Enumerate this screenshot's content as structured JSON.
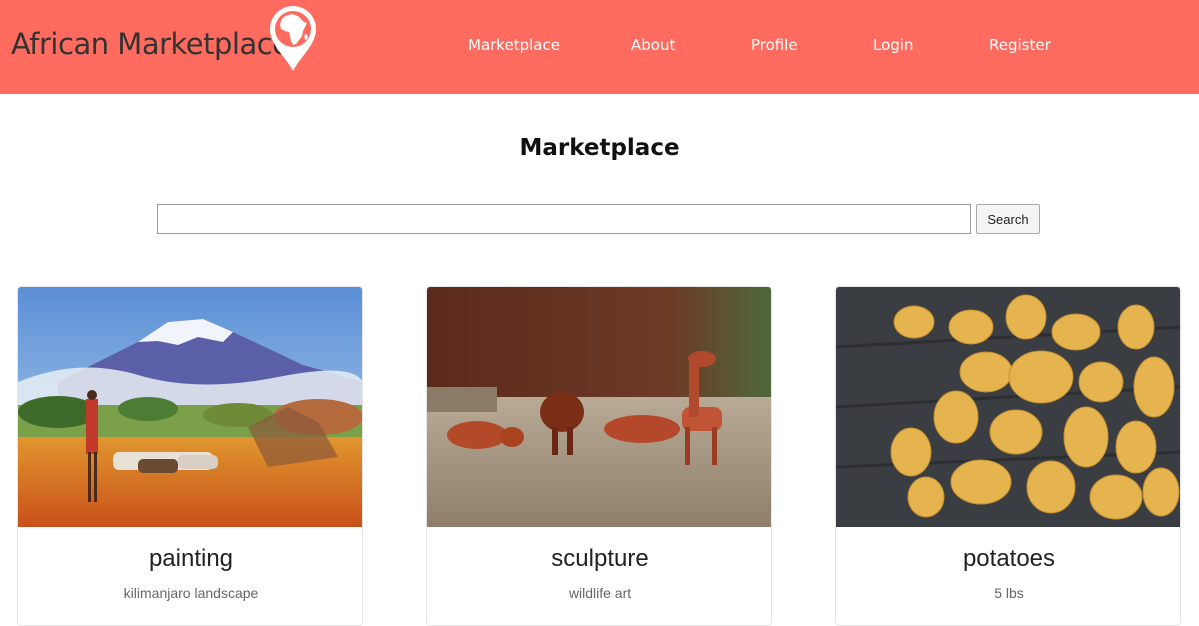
{
  "header": {
    "brand": "African Marketplace",
    "background_color": "#ff6b5f",
    "logo_icon": "africa-map-pin-icon",
    "nav": [
      {
        "label": "Marketplace"
      },
      {
        "label": "About"
      },
      {
        "label": "Profile"
      },
      {
        "label": "Login"
      },
      {
        "label": "Register"
      }
    ]
  },
  "main": {
    "title": "Marketplace",
    "search": {
      "value": "",
      "placeholder": "",
      "button_label": "Search"
    },
    "products": [
      {
        "title": "painting",
        "description": "kilimanjaro landscape",
        "image": "kilimanjaro-painting"
      },
      {
        "title": "sculpture",
        "description": "wildlife art",
        "image": "wooden-animal-sculptures"
      },
      {
        "title": "potatoes",
        "description": "5 lbs",
        "image": "potatoes-photo"
      }
    ]
  }
}
